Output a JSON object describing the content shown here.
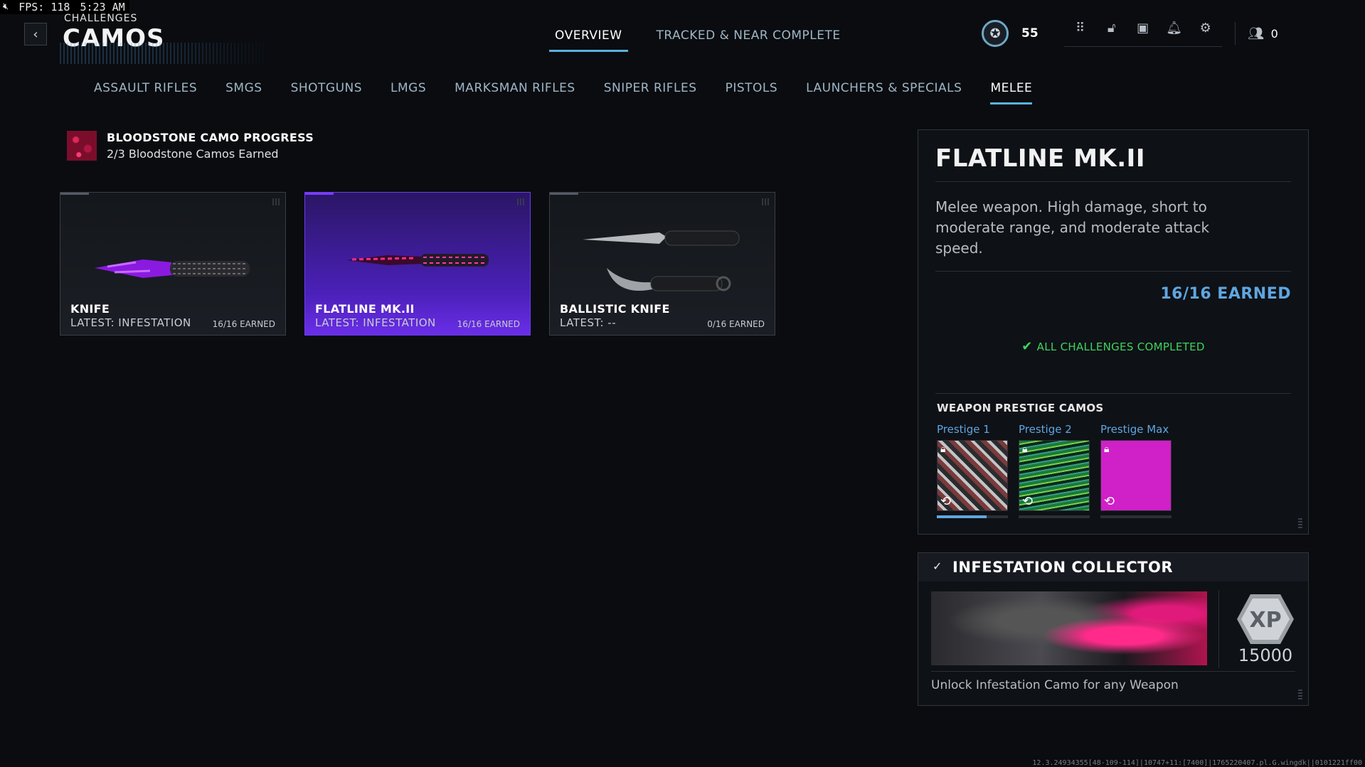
{
  "overlay": {
    "fps": "FPS: 118",
    "time": "5:23 AM"
  },
  "header": {
    "breadcrumb": "CHALLENGES",
    "title": "CAMOS"
  },
  "top_tabs": [
    {
      "label": "OVERVIEW",
      "active": true
    },
    {
      "label": "TRACKED & NEAR COMPLETE",
      "active": false
    }
  ],
  "hud": {
    "level": "55",
    "friends_count": "0"
  },
  "category_tabs": [
    {
      "label": "ASSAULT RIFLES"
    },
    {
      "label": "SMGS"
    },
    {
      "label": "SHOTGUNS"
    },
    {
      "label": "LMGS"
    },
    {
      "label": "MARKSMAN RIFLES"
    },
    {
      "label": "SNIPER RIFLES"
    },
    {
      "label": "PISTOLS"
    },
    {
      "label": "LAUNCHERS & SPECIALS"
    },
    {
      "label": "MELEE"
    }
  ],
  "progress": {
    "title": "BLOODSTONE CAMO PROGRESS",
    "subtitle": "2/3 Bloodstone Camos Earned"
  },
  "weapons": [
    {
      "name": "KNIFE",
      "latest": "LATEST: INFESTATION",
      "earned": "16/16 EARNED"
    },
    {
      "name": "FLATLINE MK.II",
      "latest": "LATEST: INFESTATION",
      "earned": "16/16 EARNED"
    },
    {
      "name": "BALLISTIC KNIFE",
      "latest": "LATEST: --",
      "earned": "0/16 EARNED"
    }
  ],
  "detail": {
    "title": "FLATLINE MK.II",
    "description": "Melee weapon. High damage, short to moderate range, and moderate attack speed.",
    "earned": "16/16 EARNED",
    "status": "ALL CHALLENGES COMPLETED",
    "prestige_heading": "WEAPON PRESTIGE CAMOS",
    "prestige": [
      {
        "label": "Prestige 1",
        "progress": 0.7
      },
      {
        "label": "Prestige 2",
        "progress": 0
      },
      {
        "label": "Prestige Max",
        "progress": 0
      }
    ]
  },
  "collector": {
    "title": "INFESTATION COLLECTOR",
    "xp_label": "XP",
    "xp": "15000",
    "description": "Unlock Infestation Camo for any Weapon"
  },
  "build": "12.3.24934355[48-109-114]|10747+11:[7400]|1765220407.pl.G.wingdk||0101221ff00",
  "colors": {
    "accent": "#5ab1de",
    "selected": "#6a2ee8",
    "success": "#3ed45c"
  }
}
